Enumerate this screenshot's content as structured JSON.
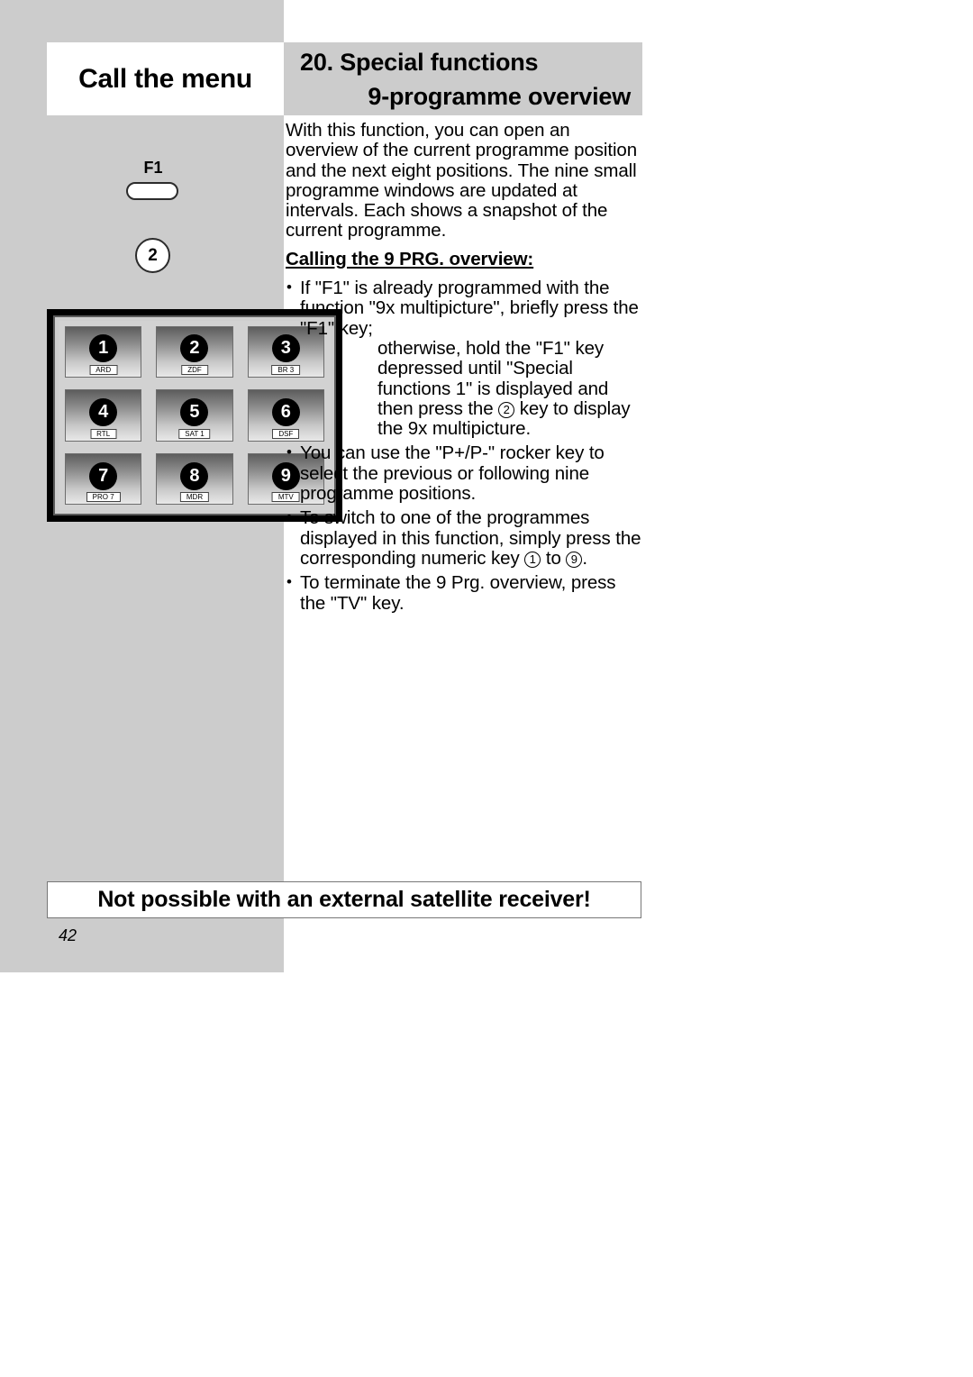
{
  "header": {
    "menu_box_label": "Call the menu",
    "title_line1": "20. Special functions",
    "title_line2": "9-programme overview"
  },
  "sidebar": {
    "f1_label": "F1",
    "key_2_label": "2"
  },
  "content": {
    "intro": "With this function, you can open an overview of the current programme position and the next eight positions. The nine small programme windows are updated at intervals. Each shows a snapshot of the current programme.",
    "subhead": "Calling the 9 PRG. overview:",
    "bullet1_part1": "If \"F1\" is already programmed with the function \"9x multipicture\", briefly press the \"F1\" key;",
    "bullet1_part2_a": "otherwise, hold the \"F1\" key depressed until \"Special functions 1\" is displayed and then press the",
    "bullet1_key": "2",
    "bullet1_part2_b": "key to display the 9x multipicture.",
    "bullet2": "You can use the \"P+/P-\" rocker key to select the previous or following nine programme positions.",
    "bullet3_a": "To switch to one of the programmes displayed in this function, simply press the corresponding numeric key",
    "bullet3_key_from": "1",
    "bullet3_mid": "to",
    "bullet3_key_to": "9",
    "bullet3_end": ".",
    "bullet4": "To terminate the 9 Prg. overview, press the \"TV\" key."
  },
  "tv_overview": {
    "cells": [
      {
        "number": "1",
        "channel": "ARD"
      },
      {
        "number": "2",
        "channel": "ZDF"
      },
      {
        "number": "3",
        "channel": "BR 3"
      },
      {
        "number": "4",
        "channel": "RTL"
      },
      {
        "number": "5",
        "channel": "SAT 1"
      },
      {
        "number": "6",
        "channel": "DSF"
      },
      {
        "number": "7",
        "channel": "PRO 7"
      },
      {
        "number": "8",
        "channel": "MDR"
      },
      {
        "number": "9",
        "channel": "MTV"
      }
    ]
  },
  "footer": {
    "banner_text": "Not possible with an external satellite receiver!",
    "page_number": "42"
  },
  "colors": {
    "panel_gray": "#cccccc",
    "text_black": "#000000",
    "paper_white": "#ffffff"
  }
}
